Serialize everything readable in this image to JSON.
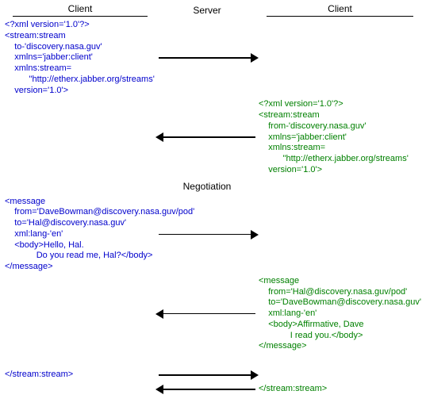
{
  "header": {
    "left": "Client",
    "mid": "Server",
    "right": "Client"
  },
  "negotiation_label": "Negotiation",
  "msgs": {
    "client1_open": "<?xml version='1.0'?>\n<stream:stream\n    to-'discovery.nasa.guv'\n    xmlns='jabber:client'\n    xmlns:stream=\n          \"http://etherx.jabber.org/streams'\n    version='1.0'>",
    "server_open": "<?xml version='1.0'?>\n<stream:stream\n    from-'discovery.nasa.guv'\n    xmlns='jabber:client'\n    xmlns:stream=\n          \"http://etherx.jabber.org/streams'\n    version='1.0'>",
    "client1_msg": "<message\n    from='DaveBowman@discovery.nasa.guv/pod'\n    to='Hal@discovery.nasa.guv'\n    xml:lang-'en'\n    <body>Hello, Hal.\n             Do you read me, Hal?</body>\n</message>",
    "server_msg": "<message\n    from='Hal@discovery.nasa.guv/pod'\n    to='DaveBowman@discovery.nasa.guv'\n    xml:lang-'en'\n    <body>Affirmative, Dave\n             I read you.</body>\n</message>",
    "client1_close": "</stream:stream>",
    "server_close": "</stream:stream>"
  }
}
